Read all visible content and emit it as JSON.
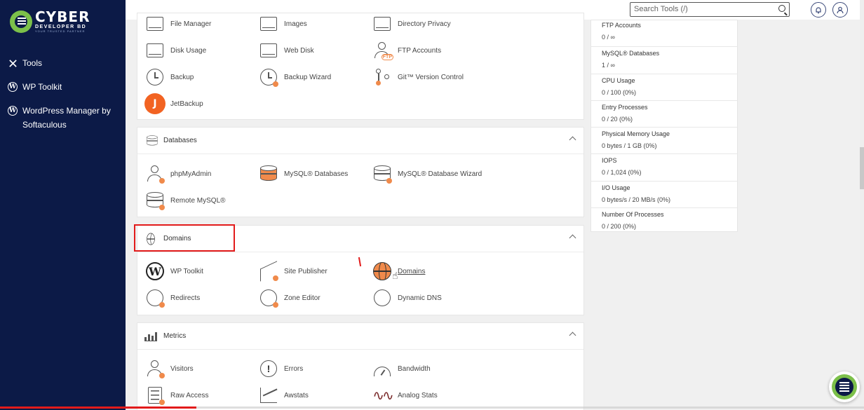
{
  "brand": {
    "name": "CYBER",
    "sub": "DEVELOPER BD",
    "tagline": "YOUR TRUSTED PARTNER"
  },
  "sidebar": {
    "items": [
      {
        "label": "Tools",
        "icon": "tools-icon"
      },
      {
        "label": "WP Toolkit",
        "icon": "wordpress-icon"
      },
      {
        "label": "WordPress Manager by Softaculous",
        "icon": "wordpress-icon"
      }
    ]
  },
  "topbar": {
    "search_placeholder": "Search Tools (/)"
  },
  "files": {
    "items": [
      {
        "label": "File Manager"
      },
      {
        "label": "Images"
      },
      {
        "label": "Directory Privacy"
      },
      {
        "label": "Disk Usage"
      },
      {
        "label": "Web Disk"
      },
      {
        "label": "FTP Accounts"
      },
      {
        "label": "Backup"
      },
      {
        "label": "Backup Wizard"
      },
      {
        "label": "Git™ Version Control"
      },
      {
        "label": "JetBackup"
      }
    ]
  },
  "databases": {
    "title": "Databases",
    "items": [
      {
        "label": "phpMyAdmin"
      },
      {
        "label": "MySQL® Databases"
      },
      {
        "label": "MySQL® Database Wizard"
      },
      {
        "label": "Remote MySQL®"
      }
    ]
  },
  "domains": {
    "title": "Domains",
    "items": [
      {
        "label": "WP Toolkit"
      },
      {
        "label": "Site Publisher"
      },
      {
        "label": "Domains"
      },
      {
        "label": "Redirects"
      },
      {
        "label": "Zone Editor"
      },
      {
        "label": "Dynamic DNS"
      }
    ]
  },
  "metrics": {
    "title": "Metrics",
    "items": [
      {
        "label": "Visitors"
      },
      {
        "label": "Errors"
      },
      {
        "label": "Bandwidth"
      },
      {
        "label": "Raw Access"
      },
      {
        "label": "Awstats"
      },
      {
        "label": "Analog Stats"
      }
    ]
  },
  "stats": [
    {
      "label": "FTP Accounts",
      "value": "0 / ∞"
    },
    {
      "label": "MySQL® Databases",
      "value": "1 / ∞"
    },
    {
      "label": "CPU Usage",
      "value": "0 / 100   (0%)"
    },
    {
      "label": "Entry Processes",
      "value": "0 / 20   (0%)"
    },
    {
      "label": "Physical Memory Usage",
      "value": "0 bytes / 1 GB   (0%)"
    },
    {
      "label": "IOPS",
      "value": "0 / 1,024   (0%)"
    },
    {
      "label": "I/O Usage",
      "value": "0 bytes/s / 20 MB/s   (0%)"
    },
    {
      "label": "Number Of Processes",
      "value": "0 / 200   (0%)"
    }
  ],
  "video_progress": 0.227,
  "colors": {
    "sidebar": "#0c1a47",
    "accent": "#f08a4b",
    "highlight": "#e21b1b",
    "brand_green": "#7cc04a"
  }
}
